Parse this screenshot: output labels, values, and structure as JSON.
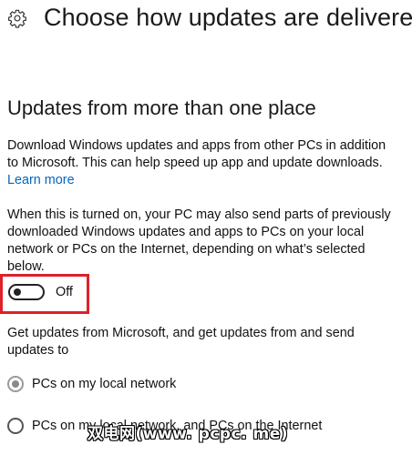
{
  "header": {
    "title": "Choose how updates are delivered",
    "icon": "gear-icon"
  },
  "section": {
    "title": "Updates from more than one place",
    "description": "Download Windows updates and apps from other PCs in addition to Microsoft. This can help speed up app and update downloads.",
    "learn_more": "Learn more",
    "toggle_info": "When this is turned on, your PC may also send parts of previously downloaded Windows updates and apps to PCs on your local network or PCs on the Internet, depending on what’s selected below.",
    "toggle": {
      "state_label": "Off",
      "on": false
    },
    "options_intro": "Get updates from Microsoft, and get updates from and send updates to",
    "options": [
      {
        "label": "PCs on my local network",
        "selected": true
      },
      {
        "label": "PCs on my local network, and PCs on the Internet",
        "selected": false
      }
    ]
  },
  "overlay": {
    "watermark": "双电网(www. pcpc. me)"
  },
  "colors": {
    "link": "#0067c0",
    "highlight_border": "#e0202a"
  }
}
